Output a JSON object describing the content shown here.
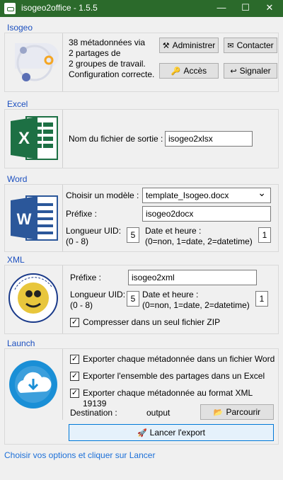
{
  "window": {
    "title": "isogeo2office - 1.5.5",
    "minimize": "—",
    "maximize": "☐",
    "close": "✕"
  },
  "isogeo": {
    "section": "Isogeo",
    "info_line1": "38 métadonnées via",
    "info_line2": "2 partages de",
    "info_line3": "2 groupes de travail.",
    "info_line4": "Configuration correcte.",
    "admin_label": "Administrer",
    "contact_label": "Contacter",
    "access_label": "Accès",
    "report_label": "Signaler"
  },
  "excel": {
    "section": "Excel",
    "output_label": "Nom du fichier de sortie :",
    "output_value": "isogeo2xlsx"
  },
  "word": {
    "section": "Word",
    "model_label": "Choisir un modèle :",
    "model_value": "template_Isogeo.docx",
    "prefix_label": "Préfixe :",
    "prefix_value": "isogeo2docx",
    "uid_label_1": "Longueur UID:",
    "uid_label_2": "(0 - 8)",
    "uid_value": "5",
    "date_label_1": "Date et heure :",
    "date_label_2": "(0=non, 1=date, 2=datetime)",
    "date_value": "1"
  },
  "xml": {
    "section": "XML",
    "prefix_label": "Préfixe :",
    "prefix_value": "isogeo2xml",
    "uid_label_1": "Longueur UID:",
    "uid_label_2": "(0 - 8)",
    "uid_value": "5",
    "date_label_1": "Date et heure :",
    "date_label_2": "(0=non, 1=date, 2=datetime)",
    "date_value": "1",
    "zip_label": "Compresser dans un seul fichier ZIP",
    "zip_checked": true
  },
  "launch": {
    "section": "Launch",
    "opt_word": "Exporter chaque métadonnée dans un fichier Word",
    "opt_excel": "Exporter l'ensemble des partages dans un Excel",
    "opt_xml": "Exporter chaque métadonnée au format XML 19139",
    "destination_label": "Destination :",
    "destination_value": "output",
    "browse_label": "Parcourir",
    "export_label": "Lancer l'export"
  },
  "status": "Choisir vos options et cliquer sur Lancer",
  "colors": {
    "title_bar": "#2b6a2b",
    "section_label": "#1b4fbf",
    "status_text": "#1b6fd8",
    "excel_green": "#1d7044",
    "word_blue": "#2b579a"
  }
}
